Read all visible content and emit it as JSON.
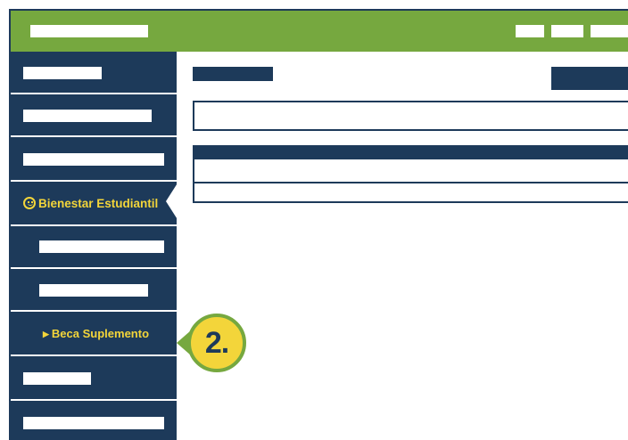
{
  "sidebar": {
    "items": [
      {
        "label": "",
        "kind": "placeholder"
      },
      {
        "label": "",
        "kind": "placeholder"
      },
      {
        "label": "",
        "kind": "placeholder"
      },
      {
        "label": "Bienestar Estudiantil",
        "icon": "smiley-icon",
        "active": true
      },
      {
        "label": "",
        "kind": "placeholder"
      },
      {
        "label": "",
        "kind": "placeholder"
      },
      {
        "label": "Beca Suplemento",
        "icon": "caret-right-icon"
      },
      {
        "label": "",
        "kind": "placeholder"
      },
      {
        "label": "",
        "kind": "placeholder"
      }
    ]
  },
  "callout": {
    "text": "2."
  },
  "colors": {
    "brand_green": "#76a83f",
    "navy": "#1d3a5a",
    "accent_yellow": "#f3d53a",
    "background": "#ffffff"
  }
}
